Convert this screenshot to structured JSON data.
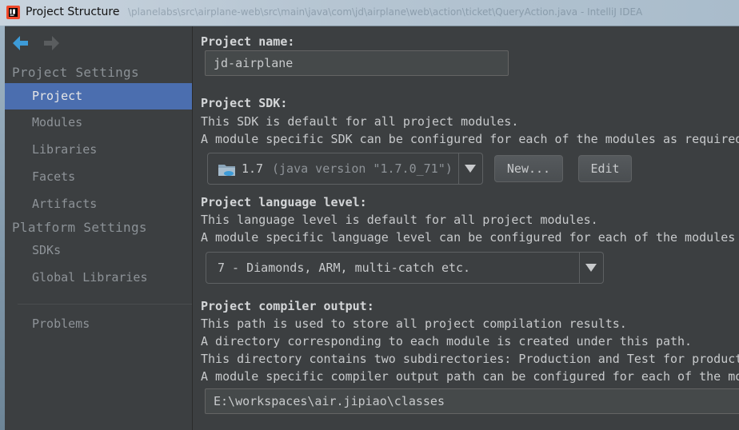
{
  "window": {
    "title": "Project Structure",
    "background_title": "\\planelabs\\src\\airplane-web\\src\\main\\java\\com\\jd\\airplane\\web\\action\\ticket\\QueryAction.java - IntelliJ IDEA"
  },
  "sidebar": {
    "project_settings_header": "Project Settings",
    "project_items": [
      "Project",
      "Modules",
      "Libraries",
      "Facets",
      "Artifacts"
    ],
    "platform_settings_header": "Platform Settings",
    "platform_items": [
      "SDKs",
      "Global Libraries"
    ],
    "other_items": [
      "Problems"
    ],
    "selected": "Project"
  },
  "main": {
    "project_name": {
      "label": "Project name:",
      "value": "jd-airplane"
    },
    "project_sdk": {
      "label": "Project SDK:",
      "desc1": "This SDK is default for all project modules.",
      "desc2": "A module specific SDK can be configured for each of the modules as required.",
      "selected_version": "1.7",
      "selected_detail": "(java version \"1.7.0_71\")",
      "new_button": "New...",
      "edit_button": "Edit"
    },
    "language_level": {
      "label": "Project language level:",
      "desc1": "This language level is default for all project modules.",
      "desc2": "A module specific language level can be configured for each of the modules as required.",
      "selected": "7 - Diamonds, ARM, multi-catch etc."
    },
    "compiler_output": {
      "label": "Project compiler output:",
      "desc1": "This path is used to store all project compilation results.",
      "desc2": "A directory corresponding to each module is created under this path.",
      "desc3": "This directory contains two subdirectories: Production and Test for production code and test sources, respectively.",
      "desc4": "A module specific compiler output path can be configured for each of the modules as required.",
      "value": "E:\\workspaces\\air.jipiao\\classes"
    }
  },
  "colors": {
    "selection": "#4b6eaf",
    "panel": "#3c3f41",
    "arrow_active": "#3d9bd8"
  }
}
